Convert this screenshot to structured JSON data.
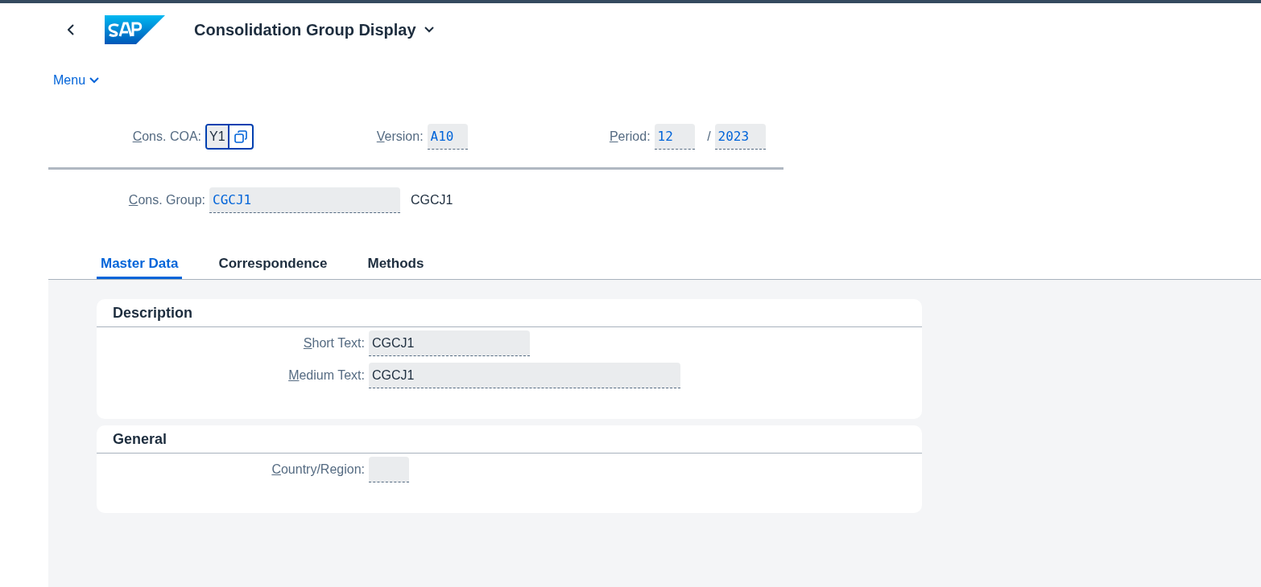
{
  "header": {
    "title": "Consolidation Group Display"
  },
  "menu": {
    "label": "Menu"
  },
  "selection": [
    {
      "label": "Cons. COA:",
      "value": "Y1",
      "kind": "valuehelp"
    },
    {
      "label": "Version:",
      "value": "A10",
      "kind": "field"
    },
    {
      "label": "Period:",
      "value": "12",
      "kind": "field"
    },
    {
      "label": "/",
      "value": "2023",
      "kind": "field"
    }
  ],
  "group": {
    "label": "Cons. Group:",
    "value": "CGCJ1",
    "description": "CGCJ1"
  },
  "tabs": [
    {
      "label": "Master Data",
      "selected": true
    },
    {
      "label": "Correspondence",
      "selected": false
    },
    {
      "label": "Methods",
      "selected": false
    }
  ],
  "sections": [
    {
      "title": "Description",
      "fields": [
        {
          "label": "Short Text:",
          "value": "CGCJ1"
        },
        {
          "label": "Medium Text:",
          "value": "CGCJ1"
        }
      ]
    },
    {
      "title": "General",
      "fields": [
        {
          "label": "Country/Region:"
        }
      ]
    }
  ]
}
